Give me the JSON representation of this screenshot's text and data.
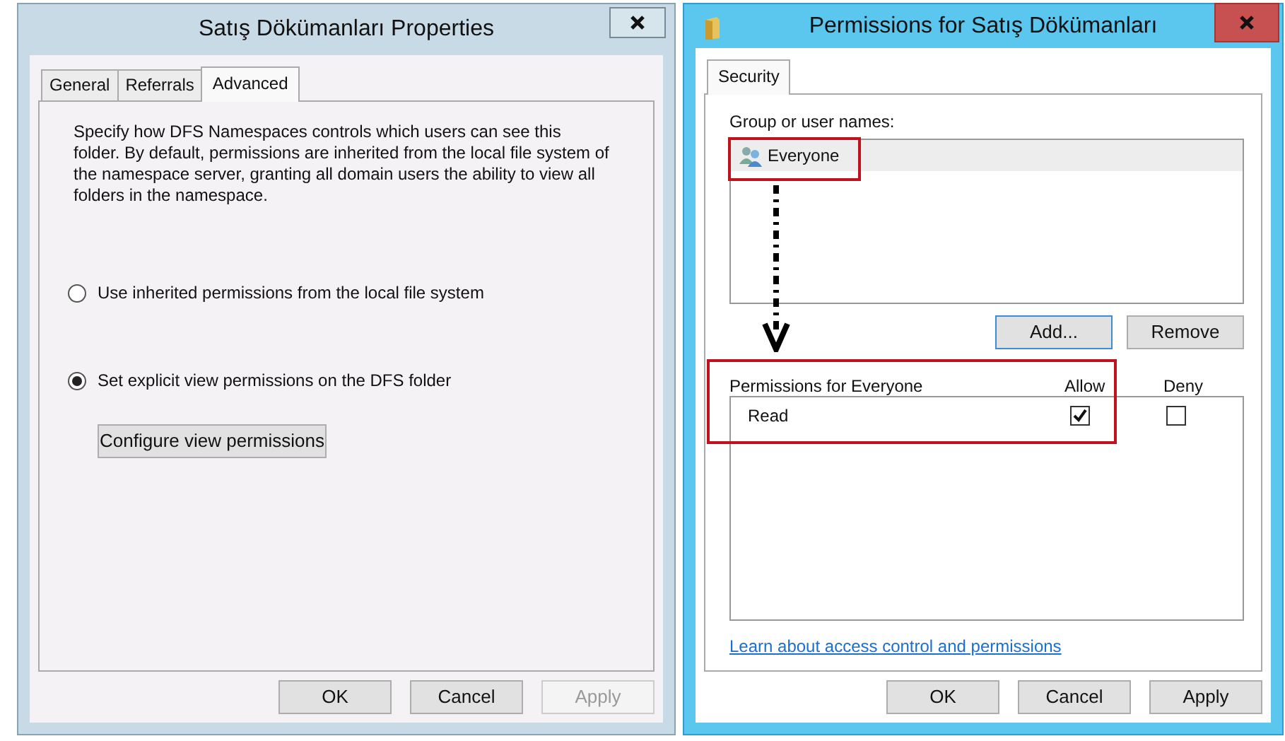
{
  "properties_dialog": {
    "title": "Satış Dökümanları Properties",
    "tabs": [
      {
        "label": "General",
        "selected": false
      },
      {
        "label": "Referrals",
        "selected": false
      },
      {
        "label": "Advanced",
        "selected": true
      }
    ],
    "description": "Specify how DFS Namespaces controls which users can see this folder. By default, permissions are inherited from the local file system of the namespace server, granting all domain users the ability to view all folders in the namespace.",
    "options": [
      {
        "label": "Use inherited permissions from the local file system",
        "selected": false
      },
      {
        "label": "Set explicit view permissions on the DFS folder",
        "selected": true
      }
    ],
    "configure_button": "Configure view permissions",
    "buttons": [
      {
        "label": "OK",
        "disabled": false
      },
      {
        "label": "Cancel",
        "disabled": false
      },
      {
        "label": "Apply",
        "disabled": true
      }
    ]
  },
  "permissions_dialog": {
    "title": "Permissions for Satış Dökümanları",
    "tabs": [
      {
        "label": "Security",
        "selected": true
      }
    ],
    "group_label": "Group or user names:",
    "users": [
      {
        "name": "Everyone",
        "selected": true
      }
    ],
    "user_buttons": [
      "Add...",
      "Remove"
    ],
    "permissions_header": "Permissions for Everyone",
    "columns": [
      "Allow",
      "Deny"
    ],
    "permissions": [
      {
        "name": "Read",
        "allow": true,
        "deny": false
      }
    ],
    "link": "Learn about access control and permissions",
    "buttons": [
      {
        "label": "OK",
        "disabled": false
      },
      {
        "label": "Cancel",
        "disabled": false
      },
      {
        "label": "Apply",
        "disabled": false
      }
    ]
  }
}
